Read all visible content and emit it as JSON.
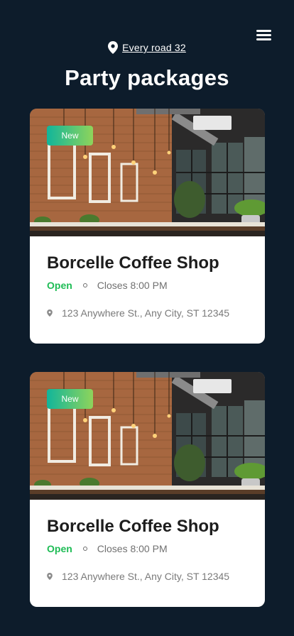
{
  "header": {
    "menu_icon": "hamburger-menu-icon",
    "location_icon": "map-pin-icon",
    "location_text": "Every road 32",
    "title": "Party packages"
  },
  "cards": [
    {
      "badge": "New",
      "name": "Borcelle Coffee Shop",
      "status": "Open",
      "closes": "Closes 8:00 PM",
      "address": "123 Anywhere St., Any City, ST 12345"
    },
    {
      "badge": "New",
      "name": "Borcelle Coffee Shop",
      "status": "Open",
      "closes": "Closes 8:00 PM",
      "address": "123 Anywhere St., Any City, ST 12345"
    }
  ],
  "colors": {
    "background": "#0d1c2b",
    "card": "#ffffff",
    "open_status": "#1ebc55",
    "badge_gradient_start": "#11b59a",
    "badge_gradient_end": "#8fd45b"
  }
}
